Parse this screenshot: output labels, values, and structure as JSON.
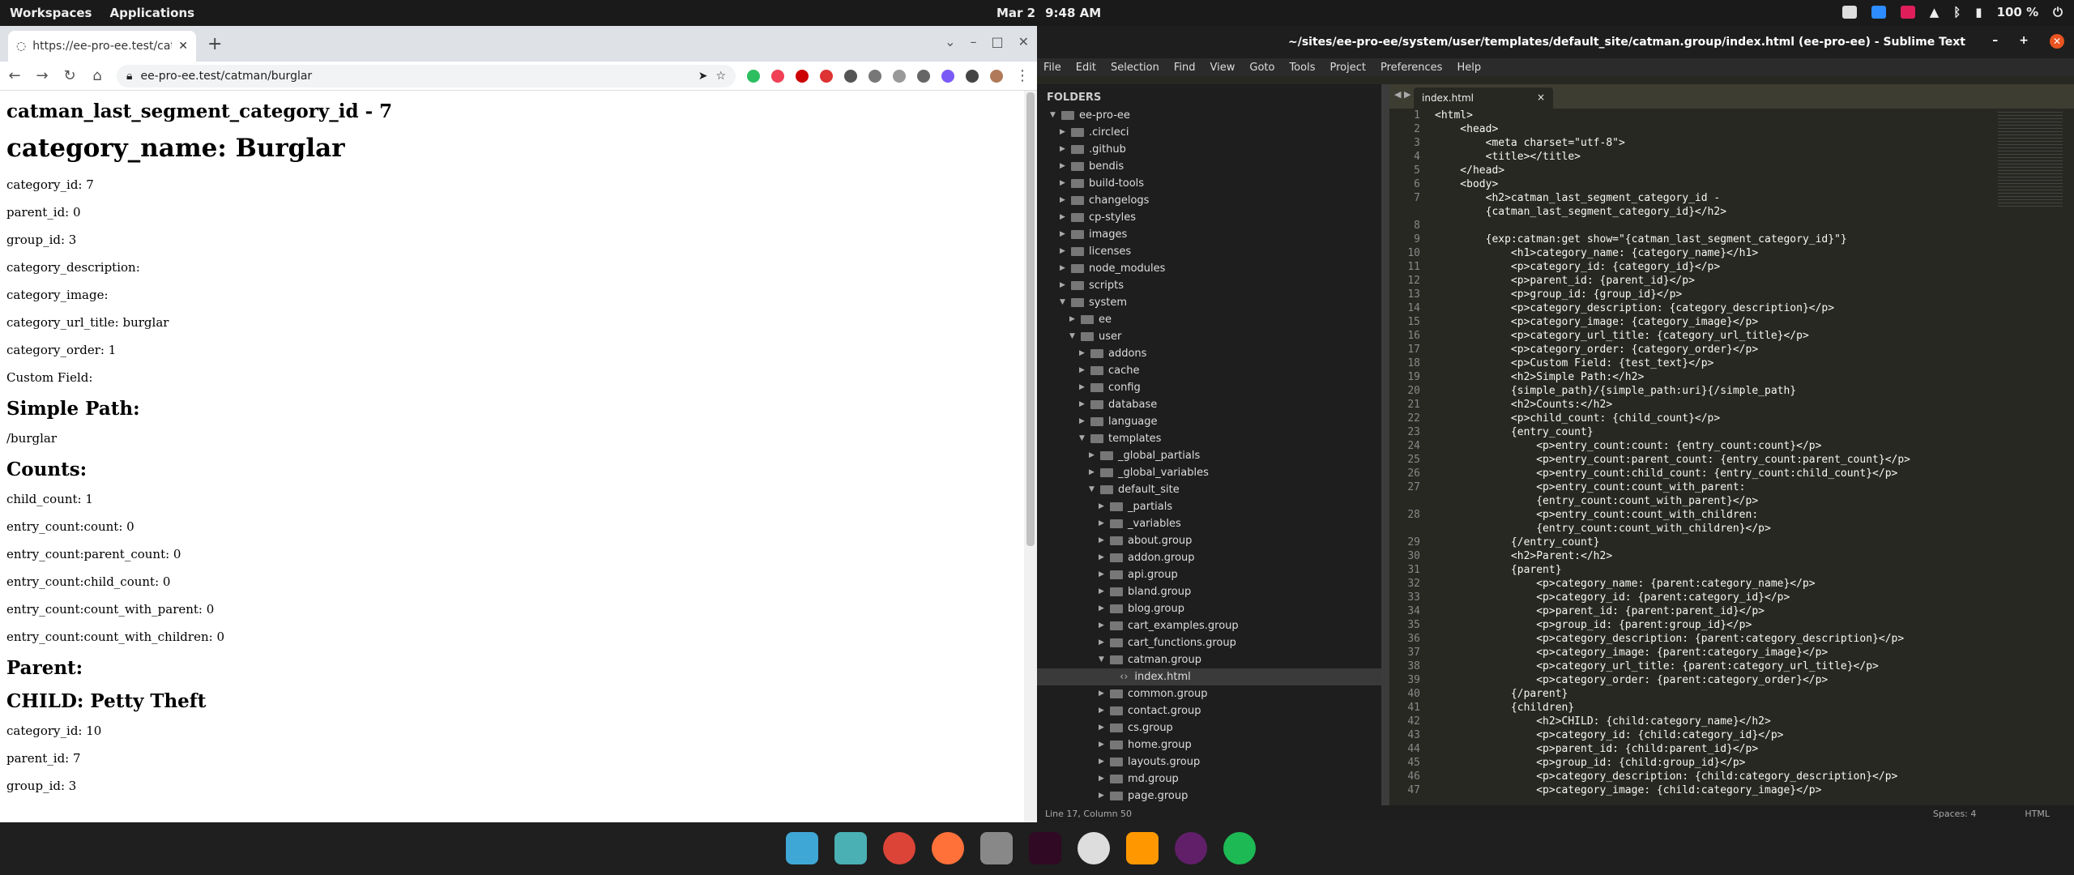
{
  "topbar": {
    "workspaces": "Workspaces",
    "applications": "Applications",
    "date": "Mar 2",
    "time": "9:48 AM",
    "battery": "100 %"
  },
  "chrome": {
    "tab_title": "https://ee-pro-ee.test/catm",
    "url": "ee-pro-ee.test/catman/burglar",
    "page": {
      "h_last_segment": "catman_last_segment_category_id - 7",
      "h_category_name": "category_name: Burglar",
      "lines": [
        "category_id: 7",
        "parent_id: 0",
        "group_id: 3",
        "category_description:",
        "category_image:",
        "category_url_title: burglar",
        "category_order: 1",
        "Custom Field:"
      ],
      "h_simple_path": "Simple Path:",
      "simple_path": "/burglar",
      "h_counts": "Counts:",
      "counts": [
        "child_count: 1",
        "entry_count:count: 0",
        "entry_count:parent_count: 0",
        "entry_count:child_count: 0",
        "entry_count:count_with_parent: 0",
        "entry_count:count_with_children: 0"
      ],
      "h_parent": "Parent:",
      "h_child": "CHILD: Petty Theft",
      "child_lines": [
        "category_id: 10",
        "parent_id: 7",
        "group_id: 3"
      ]
    }
  },
  "sublime": {
    "title": "~/sites/ee-pro-ee/system/user/templates/default_site/catman.group/index.html (ee-pro-ee) - Sublime Text",
    "menu": [
      "File",
      "Edit",
      "Selection",
      "Find",
      "View",
      "Goto",
      "Tools",
      "Project",
      "Preferences",
      "Help"
    ],
    "folders_label": "FOLDERS",
    "tree": [
      {
        "d": 0,
        "open": true,
        "label": "ee-pro-ee"
      },
      {
        "d": 1,
        "label": ".circleci"
      },
      {
        "d": 1,
        "label": ".github"
      },
      {
        "d": 1,
        "label": "bendis"
      },
      {
        "d": 1,
        "label": "build-tools"
      },
      {
        "d": 1,
        "label": "changelogs"
      },
      {
        "d": 1,
        "label": "cp-styles"
      },
      {
        "d": 1,
        "label": "images"
      },
      {
        "d": 1,
        "label": "licenses"
      },
      {
        "d": 1,
        "label": "node_modules"
      },
      {
        "d": 1,
        "label": "scripts"
      },
      {
        "d": 1,
        "open": true,
        "label": "system"
      },
      {
        "d": 2,
        "label": "ee"
      },
      {
        "d": 2,
        "open": true,
        "label": "user"
      },
      {
        "d": 3,
        "label": "addons"
      },
      {
        "d": 3,
        "label": "cache"
      },
      {
        "d": 3,
        "label": "config"
      },
      {
        "d": 3,
        "label": "database"
      },
      {
        "d": 3,
        "label": "language"
      },
      {
        "d": 3,
        "open": true,
        "label": "templates"
      },
      {
        "d": 4,
        "label": "_global_partials"
      },
      {
        "d": 4,
        "label": "_global_variables"
      },
      {
        "d": 4,
        "open": true,
        "label": "default_site"
      },
      {
        "d": 5,
        "label": "_partials"
      },
      {
        "d": 5,
        "label": "_variables"
      },
      {
        "d": 5,
        "label": "about.group"
      },
      {
        "d": 5,
        "label": "addon.group"
      },
      {
        "d": 5,
        "label": "api.group"
      },
      {
        "d": 5,
        "label": "bland.group"
      },
      {
        "d": 5,
        "label": "blog.group"
      },
      {
        "d": 5,
        "label": "cart_examples.group"
      },
      {
        "d": 5,
        "label": "cart_functions.group"
      },
      {
        "d": 5,
        "open": true,
        "label": "catman.group"
      },
      {
        "d": 6,
        "file": true,
        "sel": true,
        "label": "index.html"
      },
      {
        "d": 5,
        "label": "common.group"
      },
      {
        "d": 5,
        "label": "contact.group"
      },
      {
        "d": 5,
        "label": "cs.group"
      },
      {
        "d": 5,
        "label": "home.group"
      },
      {
        "d": 5,
        "label": "layouts.group"
      },
      {
        "d": 5,
        "label": "md.group"
      },
      {
        "d": 5,
        "label": "page.group"
      }
    ],
    "tab": "index.html",
    "code": [
      "<html>",
      "    <head>",
      "        <meta charset=\"utf-8\">",
      "        <title></title>",
      "    </head>",
      "    <body>",
      "        <h2>catman_last_segment_category_id -",
      "        {catman_last_segment_category_id}</h2>",
      "",
      "        {exp:catman:get show=\"{catman_last_segment_category_id}\"}",
      "            <h1>category_name: {category_name}</h1>",
      "            <p>category_id: {category_id}</p>",
      "            <p>parent_id: {parent_id}</p>",
      "            <p>group_id: {group_id}</p>",
      "            <p>category_description: {category_description}</p>",
      "            <p>category_image: {category_image}</p>",
      "            <p>category_url_title: {category_url_title}</p>",
      "            <p>category_order: {category_order}</p>",
      "            <p>Custom Field: {test_text}</p>",
      "            <h2>Simple Path:</h2>",
      "            {simple_path}/{simple_path:uri}{/simple_path}",
      "            <h2>Counts:</h2>",
      "            <p>child_count: {child_count}</p>",
      "            {entry_count}",
      "                <p>entry_count:count: {entry_count:count}</p>",
      "                <p>entry_count:parent_count: {entry_count:parent_count}</p>",
      "                <p>entry_count:child_count: {entry_count:child_count}</p>",
      "                <p>entry_count:count_with_parent:",
      "                {entry_count:count_with_parent}</p>",
      "                <p>entry_count:count_with_children:",
      "                {entry_count:count_with_children}</p>",
      "            {/entry_count}",
      "            <h2>Parent:</h2>",
      "            {parent}",
      "                <p>category_name: {parent:category_name}</p>",
      "                <p>category_id: {parent:category_id}</p>",
      "                <p>parent_id: {parent:parent_id}</p>",
      "                <p>group_id: {parent:group_id}</p>",
      "                <p>category_description: {parent:category_description}</p>",
      "                <p>category_image: {parent:category_image}</p>",
      "                <p>category_url_title: {parent:category_url_title}</p>",
      "                <p>category_order: {parent:category_order}</p>",
      "            {/parent}",
      "            {children}",
      "                <h2>CHILD: {child:category_name}</h2>",
      "                <p>category_id: {child:category_id}</p>",
      "                <p>parent_id: {child:parent_id}</p>",
      "                <p>group_id: {child:group_id}</p>",
      "                <p>category_description: {child:category_description}</p>",
      "                <p>category_image: {child:category_image}</p>"
    ],
    "gutter": [
      "1",
      "2",
      "3",
      "4",
      "5",
      "6",
      "7",
      "",
      "8",
      "9",
      "10",
      "11",
      "12",
      "13",
      "14",
      "15",
      "16",
      "17",
      "18",
      "19",
      "20",
      "21",
      "22",
      "23",
      "24",
      "25",
      "26",
      "27",
      "",
      "28",
      "",
      "29",
      "30",
      "31",
      "32",
      "33",
      "34",
      "35",
      "36",
      "37",
      "38",
      "39",
      "40",
      "41",
      "42",
      "43",
      "44",
      "45",
      "46",
      "47"
    ],
    "status_left": "Line 17, Column 50",
    "status_spaces": "Spaces: 4",
    "status_syntax": "HTML"
  },
  "colors": {
    "accent": "#e95420",
    "editor_bg": "#272822"
  }
}
